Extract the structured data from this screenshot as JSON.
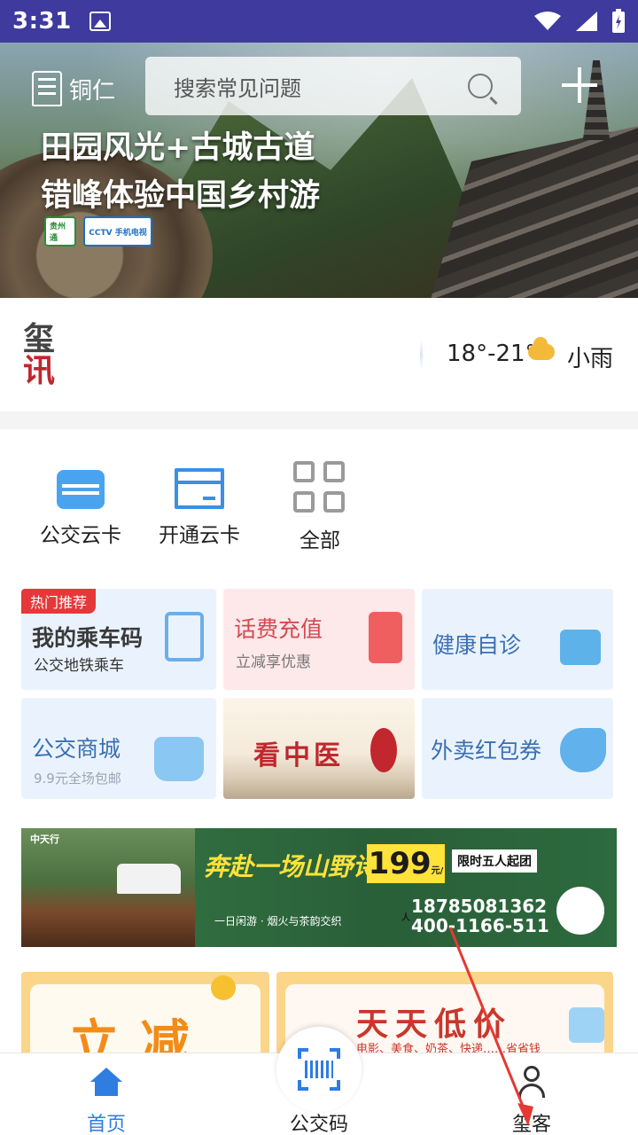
{
  "status_bar": {
    "time": "3:31"
  },
  "hero": {
    "city": "铜仁",
    "search_placeholder": "搜索常见问题",
    "headline_line1": "田园风光+古城古道",
    "headline_line2": "错峰体验中国乡村游",
    "badge1": "贵州通",
    "badge2": "CCTV 手机电视"
  },
  "news": {
    "logo_top": "玺",
    "logo_bottom": "讯",
    "temperature": "18°-21°",
    "weather": "小雨"
  },
  "quick_services": [
    {
      "label": "公交云卡",
      "icon": "bus-card-icon"
    },
    {
      "label": "开通云卡",
      "icon": "card-icon"
    },
    {
      "label": "全部",
      "icon": "grid-icon"
    }
  ],
  "tiles": {
    "hot_tag": "热门推荐",
    "ride_code": {
      "title": "我的乘车码",
      "subtitle": "公交地铁乘车"
    },
    "recharge": {
      "title": "话费充值",
      "subtitle": "立减享优惠"
    },
    "health": {
      "title": "健康自诊"
    },
    "mall": {
      "title": "公交商城",
      "subtitle": "9.9元全场包邮"
    },
    "tcm": {
      "title": "看中医"
    },
    "takeout": {
      "title": "外卖红包券"
    }
  },
  "ad_banner": {
    "brand": "中天行",
    "slogan": "奔赴一场山野诗行",
    "subtitle": "一日闲游 · 烟火与茶韵交织",
    "price": "199",
    "price_unit": "元/人",
    "tag": "限时五人起团",
    "phone1": "18785081362",
    "phone2": "400-1166-511"
  },
  "promos": {
    "left_title": "立减",
    "right_title": "天天低价",
    "right_sub": "电影、美食、奶茶、快递……省省钱"
  },
  "bottom_nav": {
    "home": "首页",
    "bus_code": "公交码",
    "me": "玺客"
  },
  "colors": {
    "accent": "#2f7de1",
    "status_bar": "#3f3a9e",
    "hot": "#e5383a"
  }
}
